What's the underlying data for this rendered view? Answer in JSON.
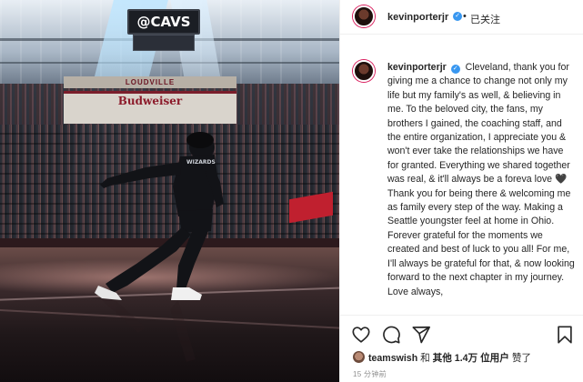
{
  "photo": {
    "scoreboard_text": "@CAVS",
    "banner_top": "LOUDVILLE",
    "banner_main": "Budweiser",
    "jersey_text": "WIZARDS"
  },
  "post": {
    "author": "kevinporterjr",
    "follow_separator": "•",
    "follow_status": "已关注",
    "caption": "Cleveland, thank you for giving me a chance to change not only my life but my family's as well, & believing in me. To the beloved city, the fans, my brothers I gained, the coaching staff, and the entire organization, I appreciate you & won't ever take the relationships we have for granted. Everything we shared together was real, & it'll always be a foreva love 🖤 Thank you for being there & welcoming me as family every step of the way. Making a Seattle youngster feel at home in Ohio. Forever grateful for the moments we created and best of luck to you all! For me, I'll always be grateful for that, & now looking forward to the next chapter in my journey. Love always,"
  },
  "likes": {
    "first_user": "teamswish",
    "connector": "和",
    "others_label": "其他 1.4万 位用户",
    "suffix": "赞了"
  },
  "timestamp": "15 分钟前",
  "icons": {
    "verified": "verified-badge-icon",
    "like": "heart-icon",
    "comment": "comment-icon",
    "share": "paper-plane-icon",
    "save": "bookmark-icon"
  },
  "colors": {
    "verified_blue": "#3897f0",
    "story_ring": "#d91c5c",
    "text": "#262626",
    "muted": "#8e8e8e"
  }
}
